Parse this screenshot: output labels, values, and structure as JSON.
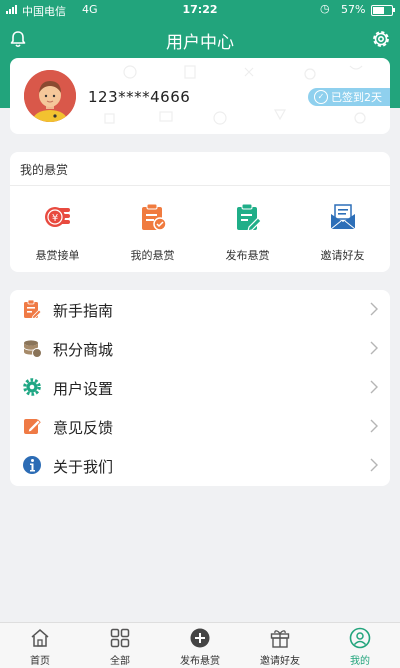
{
  "status_bar": {
    "carrier": "中国电信",
    "network": "4G",
    "time": "17:22",
    "battery": "57%"
  },
  "header": {
    "title": "用户中心"
  },
  "profile": {
    "phone": "123****4666",
    "checkin": "已签到2天"
  },
  "bounty_card": {
    "title": "我的悬赏",
    "items": [
      {
        "label": "悬赏接单",
        "icon": "coins-icon"
      },
      {
        "label": "我的悬赏",
        "icon": "task-check-icon"
      },
      {
        "label": "发布悬赏",
        "icon": "edit-doc-icon"
      },
      {
        "label": "邀请好友",
        "icon": "envelope-icon"
      }
    ]
  },
  "menu": {
    "items": [
      {
        "label": "新手指南",
        "icon": "guide-icon"
      },
      {
        "label": "积分商城",
        "icon": "coin-stack-icon"
      },
      {
        "label": "用户设置",
        "icon": "gear-icon"
      },
      {
        "label": "意见反馈",
        "icon": "feedback-icon"
      },
      {
        "label": "关于我们",
        "icon": "info-icon"
      }
    ]
  },
  "tab_bar": {
    "items": [
      {
        "label": "首页",
        "icon": "home-icon"
      },
      {
        "label": "全部",
        "icon": "grid-icon"
      },
      {
        "label": "发布悬赏",
        "icon": "plus-circle-icon"
      },
      {
        "label": "邀请好友",
        "icon": "gift-icon"
      },
      {
        "label": "我的",
        "icon": "user-icon"
      }
    ],
    "active_index": 4
  },
  "colors": {
    "brand": "#22a47c",
    "checkin_badge": "#8fd0ee"
  }
}
